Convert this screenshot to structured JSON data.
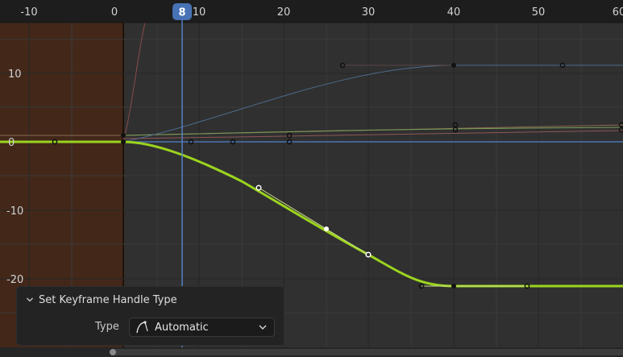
{
  "editor": {
    "current_frame": "8",
    "x_ruler": [
      "-10",
      "0",
      "10",
      "20",
      "30",
      "40",
      "50",
      "60"
    ],
    "y_ruler": [
      "10",
      "0",
      "-10",
      "-20"
    ],
    "colors": {
      "background": "#303030",
      "preview_range": "#43281a",
      "playhead": "#5680c2",
      "active_curve": "#9bd41e",
      "grid": "#3c3c3c"
    }
  },
  "operator_panel": {
    "title": "Set Keyframe Handle Type",
    "type_label": "Type",
    "type_value": "Automatic",
    "icons": {
      "collapse": "chevron-down-icon",
      "handle_type": "auto-handle-icon",
      "dropdown": "chevron-down-icon"
    }
  }
}
